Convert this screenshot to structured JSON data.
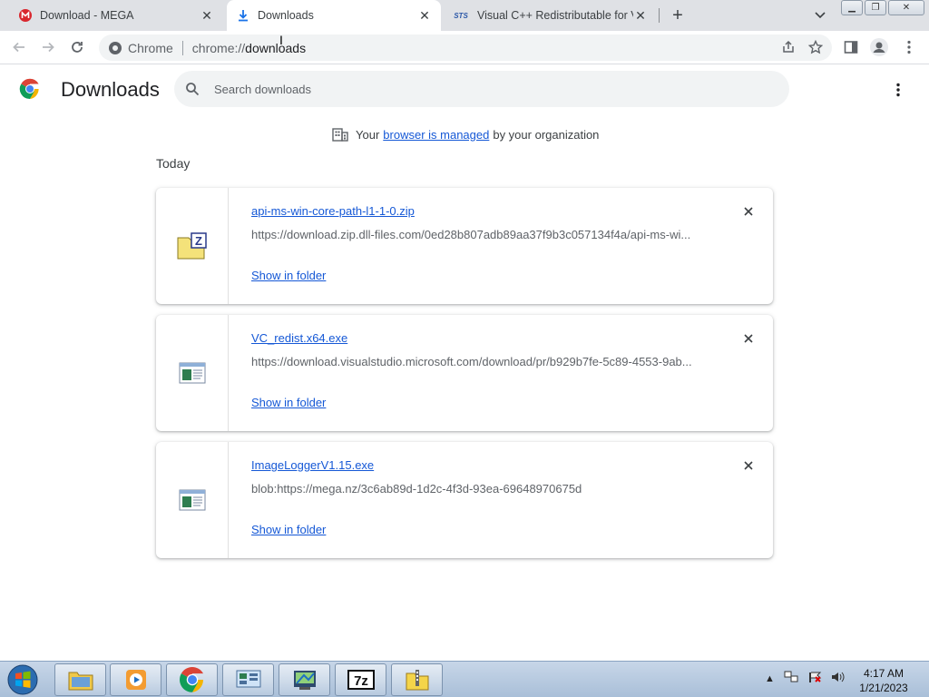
{
  "tabs": [
    {
      "label": "Download - MEGA",
      "icon": "mega-icon"
    },
    {
      "label": "Downloads",
      "icon": "download-icon",
      "active": true
    },
    {
      "label": "Visual C++ Redistributable for V",
      "icon": "sts-icon"
    }
  ],
  "omnibox": {
    "site": "Chrome",
    "url_prefix": "chrome://",
    "url_host": "downloads"
  },
  "page": {
    "title": "Downloads",
    "search_placeholder": "Search downloads"
  },
  "managed": {
    "prefix": "Your",
    "link": "browser is managed",
    "suffix": "by your organization"
  },
  "section_label": "Today",
  "downloads": [
    {
      "name": "api-ms-win-core-path-l1-1-0.zip",
      "url": "https://download.zip.dll-files.com/0ed28b807adb89aa37f9b3c057134f4a/api-ms-wi...",
      "action": "Show in folder",
      "icon": "zip-file-icon"
    },
    {
      "name": "VC_redist.x64.exe",
      "url": "https://download.visualstudio.microsoft.com/download/pr/b929b7fe-5c89-4553-9ab...",
      "action": "Show in folder",
      "icon": "exe-file-icon"
    },
    {
      "name": "ImageLoggerV1.15.exe",
      "url": "blob:https://mega.nz/3c6ab89d-1d2c-4f3d-93ea-69648970675d",
      "action": "Show in folder",
      "icon": "exe-file-icon"
    }
  ],
  "taskbar": {
    "time": "4:17 AM",
    "date": "1/21/2023"
  },
  "colors": {
    "link": "#1558d6",
    "tabstrip": "#dfe1e5",
    "omnibox": "#f1f3f4"
  }
}
